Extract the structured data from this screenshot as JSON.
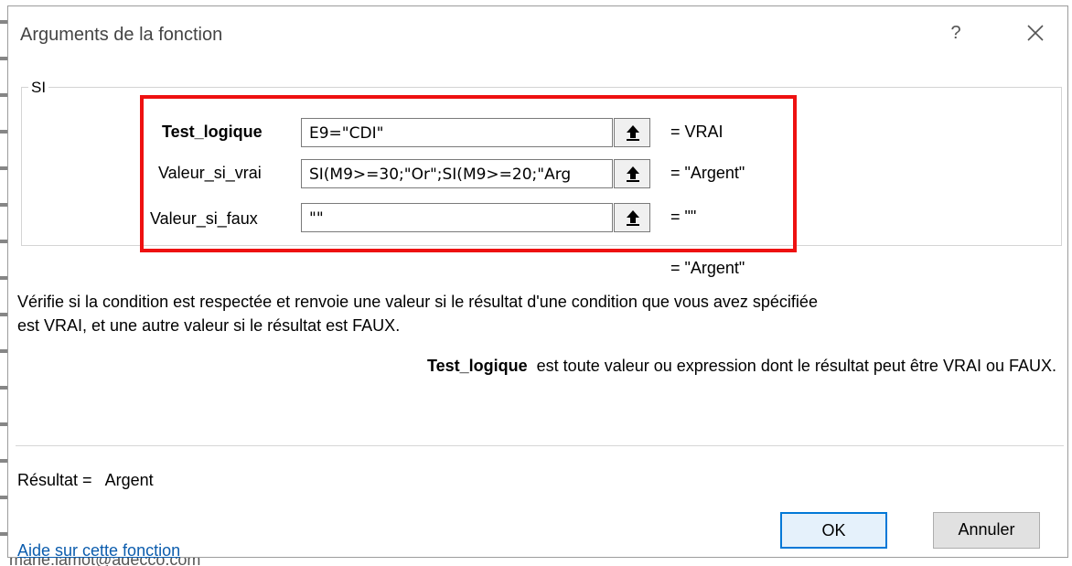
{
  "dialog": {
    "title": "Arguments de la fonction",
    "help_glyph": "?",
    "function_name": "SI"
  },
  "arguments": [
    {
      "label": "Test_logique",
      "value": "E9=\"CDI\"",
      "result": "=  VRAI",
      "bold": true
    },
    {
      "label": "Valeur_si_vrai",
      "value": "SI(M9>=30;\"Or\";SI(M9>=20;\"Arg",
      "result": "=  \"Argent\"",
      "bold": false
    },
    {
      "label": "Valeur_si_faux",
      "value": "\"\"",
      "result": "=  \"\"",
      "bold": false
    }
  ],
  "overall_result": "=  \"Argent\"",
  "description_line1": "Vérifie si la condition est respectée et renvoie une valeur si le résultat d'une condition que vous avez spécifiée",
  "description_line2": "est VRAI, et une autre valeur si le résultat est FAUX.",
  "argument_help": {
    "name": "Test_logique",
    "text": "est toute valeur ou expression dont le résultat peut être VRAI ou FAUX."
  },
  "result_label": "Résultat =",
  "result_value": "Argent",
  "help_link": "Aide sur cette fonction",
  "buttons": {
    "ok": "OK",
    "cancel": "Annuler"
  },
  "colors": {
    "highlight_border": "#ee1111",
    "link": "#0b5cad",
    "default_button_border": "#0078d7"
  },
  "background_text": "marie.lamot@adecco.com"
}
